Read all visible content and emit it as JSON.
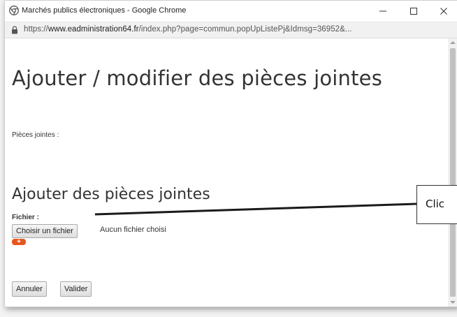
{
  "window": {
    "title": "Marchés publics électroniques - Google Chrome",
    "minimize_glyph": "—",
    "maximize_glyph": "☐",
    "close_glyph": "✕"
  },
  "address_bar": {
    "scheme": "https://",
    "host": "www.eadministration64.fr",
    "path": "/index.php?page=commun.popUpListePj&Idmsg=36952&..."
  },
  "page": {
    "title": "Ajouter / modifier des pièces jointes",
    "attachments_label": "Pièces jointes :",
    "add_section_title": "Ajouter des pièces jointes",
    "file_label": "Fichier :",
    "choose_file_button": "Choisir un fichier",
    "no_file_text": "Aucun fichier choisi",
    "add_more_button": "+",
    "cancel_button": "Annuler",
    "validate_button": "Valider"
  },
  "callout": {
    "text": "Clic"
  },
  "colors": {
    "add_button": "#e8561b",
    "page_text": "#333333",
    "connector": "#1a1a1a"
  },
  "icons": [
    "chrome-icon",
    "lock-icon",
    "minimize-icon",
    "maximize-icon",
    "close-icon",
    "plus-icon"
  ]
}
